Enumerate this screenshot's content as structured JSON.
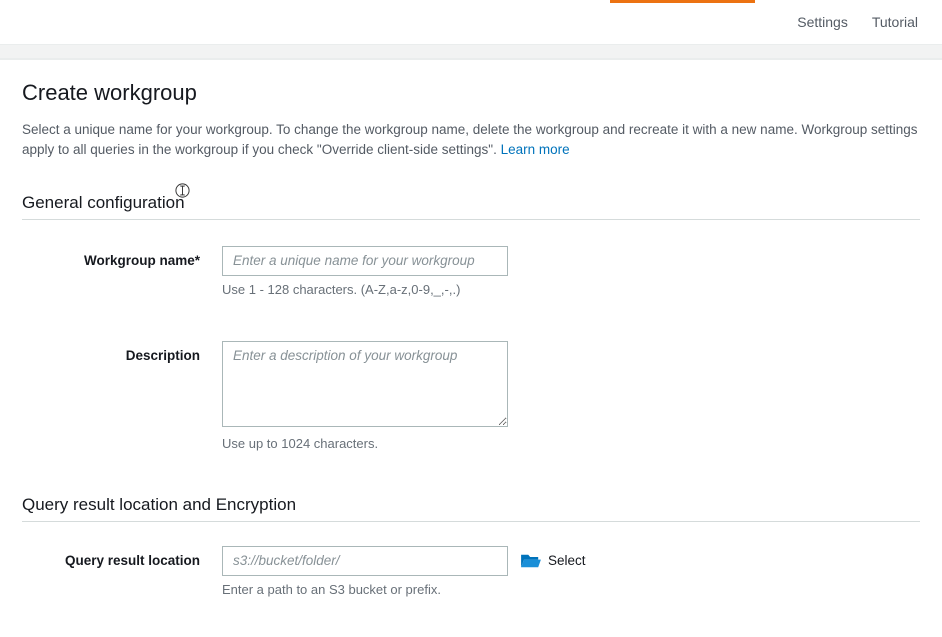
{
  "topbar": {
    "settings": "Settings",
    "tutorial": "Tutorial"
  },
  "page": {
    "title": "Create workgroup",
    "intro_part1": "Select a unique name for your workgroup. To change the workgroup name, delete the workgroup and recreate it with a new name. Workgroup settings apply to all queries in the workgroup if you check \"Override client-side settings\". ",
    "learn_more": "Learn more"
  },
  "sections": {
    "general": {
      "header": "General configuration",
      "name_label": "Workgroup name*",
      "name_placeholder": "Enter a unique name for your workgroup",
      "name_hint": "Use 1 - 128 characters. (A-Z,a-z,0-9,_,-,.)",
      "desc_label": "Description",
      "desc_placeholder": "Enter a description of your workgroup",
      "desc_hint": "Use up to 1024 characters."
    },
    "qrl": {
      "header": "Query result location and Encryption",
      "label": "Query result location",
      "placeholder": "s3://bucket/folder/",
      "select": "Select",
      "hint": "Enter a path to an S3 bucket or prefix."
    }
  }
}
